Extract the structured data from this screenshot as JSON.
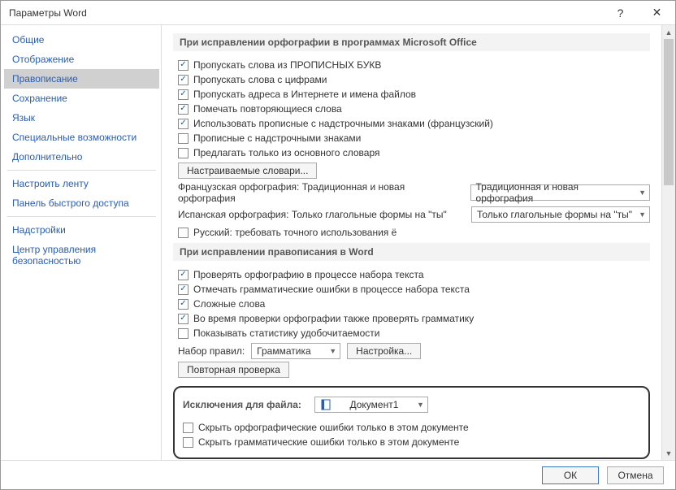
{
  "window": {
    "title": "Параметры Word",
    "help": "?",
    "close": "✕"
  },
  "sidebar": {
    "items": [
      "Общие",
      "Отображение",
      "Правописание",
      "Сохранение",
      "Язык",
      "Специальные возможности",
      "Дополнительно"
    ],
    "items2": [
      "Настроить ленту",
      "Панель быстрого доступа"
    ],
    "items3": [
      "Надстройки",
      "Центр управления безопасностью"
    ],
    "active_index": 2
  },
  "section1": {
    "title": "При исправлении орфографии в программах Microsoft Office",
    "opts": [
      {
        "checked": true,
        "text": "Пропускать слова из ПРОПИСНЫХ БУКВ",
        "acc": ""
      },
      {
        "checked": true,
        "text": "Пропускать слова с цифрами",
        "acc": "ц"
      },
      {
        "checked": true,
        "text": "Пропускать адреса в Интернете и имена файлов",
        "acc": "а"
      },
      {
        "checked": true,
        "text": "Помечать повторяющиеся слова",
        "acc": "я"
      },
      {
        "checked": true,
        "text": "Использовать прописные с надстрочными знаками (французский)"
      },
      {
        "checked": false,
        "text": "Прописные с надстрочными знаками",
        "acc": "н"
      },
      {
        "checked": false,
        "text": "Предлагать только из основного словаря",
        "acc": ""
      }
    ],
    "dict_button": "Настраиваемые словари...",
    "french_label": "Французская орфография:",
    "french_desc": "Традиционная и новая орфография",
    "french_select": "Традиционная и новая орфография",
    "spanish_label": "Испанская орфография:",
    "spanish_desc": "Только глагольные формы на \"ты\"",
    "spanish_select": "Только глагольные формы на \"ты\"",
    "russian": {
      "checked": false,
      "text": "Русский: требовать точного использования ё",
      "acc": "ё"
    }
  },
  "section2": {
    "title": "При исправлении правописания в Word",
    "opts": [
      {
        "checked": true,
        "text": "Проверять орфографию в процессе набора текста"
      },
      {
        "checked": true,
        "text": "Отмечать грамматические ошибки в процессе набора текста",
        "acc": "м"
      },
      {
        "checked": true,
        "text": "Сложные слова",
        "acc": "С"
      },
      {
        "checked": true,
        "text": "Во время проверки орфографии также проверять грамматику"
      },
      {
        "checked": false,
        "text": "Показывать статистику удобочитаемости"
      }
    ],
    "ruleset_label": "Набор правил:",
    "ruleset_select": "Грамматика",
    "settings_button": "Настройка...",
    "recheck_button": "Повторная проверка"
  },
  "section3": {
    "title": "Исключения для файла:",
    "file_select": "Документ1",
    "opts": [
      {
        "checked": false,
        "text": "Скрыть орфографические ошибки только в этом документе",
        "acc": "ф"
      },
      {
        "checked": false,
        "text": "Скрыть грамматические ошибки только в этом документе",
        "acc": "и"
      }
    ]
  },
  "footer": {
    "ok": "ОК",
    "cancel": "Отмена"
  }
}
